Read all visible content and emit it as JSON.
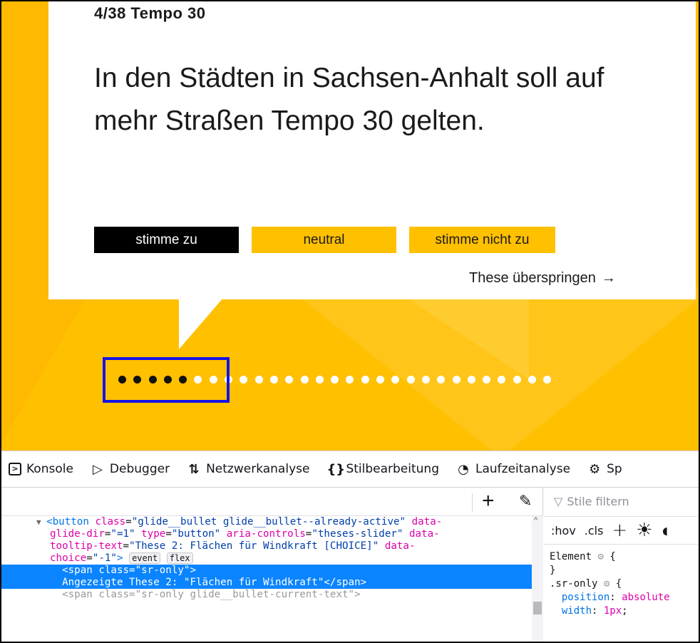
{
  "page": {
    "counter": "4/38 Tempo 30",
    "statement": "In den Städten in Sachsen-Anhalt soll auf mehr Straßen Tempo 30 gelten.",
    "buttons": {
      "agree": "stimme zu",
      "neutral": "neutral",
      "disagree": "stimme nicht zu"
    },
    "skip_label": "These überspringen",
    "skip_icon": "→",
    "progress": {
      "completed": 5,
      "total_visible": 29
    },
    "colors": {
      "accent": "#ffc000",
      "highlight": "#1414e6"
    }
  },
  "devtools": {
    "tabs": [
      {
        "icon": "console-icon",
        "glyph": ">",
        "label": "Konsole"
      },
      {
        "icon": "debugger-icon",
        "glyph": "▷",
        "label": "Debugger"
      },
      {
        "icon": "network-icon",
        "glyph": "⇅",
        "label": "Netzwerkanalyse"
      },
      {
        "icon": "style-editor-icon",
        "glyph": "{}",
        "label": "Stilbearbeitung"
      },
      {
        "icon": "performance-icon",
        "glyph": "◔",
        "label": "Laufzeitanalyse"
      },
      {
        "icon": "memory-icon",
        "glyph": "⚙",
        "label": "Sp"
      }
    ],
    "dom": {
      "line1": {
        "tag_open": "<button",
        "a1": "class",
        "v1": "\"glide__bullet glide__bullet--already-active\"",
        "a2": "data-"
      },
      "line2": {
        "a1": "glide-dir",
        "v1": "\"=1\"",
        "a2": "type",
        "v2": "\"button\"",
        "a3": "aria-controls",
        "v3": "\"theses-slider\"",
        "a4": "data-"
      },
      "line3": {
        "a1": "tooltip-text",
        "v1": "\"These 2: Flächen für Windkraft [CHOICE]\"",
        "a2": "data-"
      },
      "line4": {
        "a1": "choice",
        "v1": "\"-1\"",
        "tag_close": ">",
        "badge_event": "event",
        "badge_flex": "flex"
      },
      "line5": "<span class=\"sr-only\">",
      "line6": "Angezeigte These 2: \"Flächen für Windkraft\"</span>",
      "line7": "<span class=\"sr-only glide__bullet-current-text\">"
    },
    "styles": {
      "filter_placeholder": "Stile filtern",
      "hov": ":hov",
      "cls": ".cls",
      "rule1_selector": "Element",
      "rule1_open": "{",
      "rule1_close": "}",
      "rule2_selector": ".sr-only",
      "rule2_open": "{",
      "prop1": "position",
      "val1": "absolute",
      "prop2": "width",
      "val2": "1px"
    }
  }
}
